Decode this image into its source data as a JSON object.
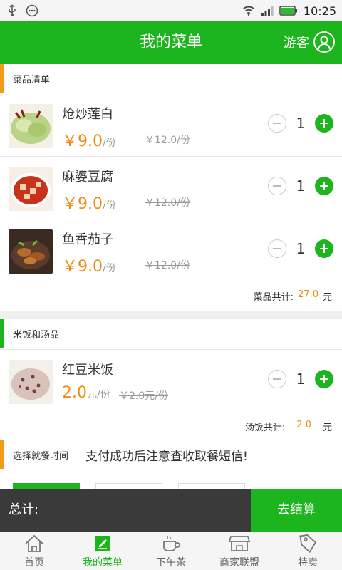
{
  "status_bar": {
    "time": "10:25"
  },
  "header": {
    "title": "我的菜单",
    "user_label": "游客"
  },
  "sections": {
    "dishes": {
      "label": "菜品清单",
      "items": [
        {
          "name": "炝炒莲白",
          "price": "￥9.0",
          "unit": "/份",
          "old_price": "￥12.0/份",
          "qty": "1"
        },
        {
          "name": "麻婆豆腐",
          "price": "￥9.0",
          "unit": "/份",
          "old_price": "￥12.0/份",
          "qty": "1"
        },
        {
          "name": "鱼香茄子",
          "price": "￥9.0",
          "unit": "/份",
          "old_price": "￥12.0/份",
          "qty": "1"
        }
      ],
      "subtotal_label": "菜品共计:",
      "subtotal_value": "27.0",
      "subtotal_unit": "元"
    },
    "rice_soup": {
      "label": "米饭和汤品",
      "items": [
        {
          "name": "红豆米饭",
          "price": "2.0",
          "unit": "元/份",
          "old_price": "￥2.0元/份",
          "qty": "1"
        }
      ],
      "subtotal_label": "汤饭共计:",
      "subtotal_value": "2.0",
      "subtotal_unit": "元"
    }
  },
  "pickup": {
    "label": "选择就餐时间",
    "notice": "支付成功后注意查收取餐短信!"
  },
  "checkout": {
    "total_label": "总计:",
    "button": "去结算"
  },
  "nav": [
    {
      "label": "首页",
      "icon": "home-icon"
    },
    {
      "label": "我的菜单",
      "icon": "menu-icon"
    },
    {
      "label": "下午茶",
      "icon": "cup-icon"
    },
    {
      "label": "商家联盟",
      "icon": "store-icon"
    },
    {
      "label": "特卖",
      "icon": "tag-icon"
    }
  ],
  "colors": {
    "accent": "#1db51d",
    "price": "#f28b12",
    "marker": "#f39a1b"
  }
}
